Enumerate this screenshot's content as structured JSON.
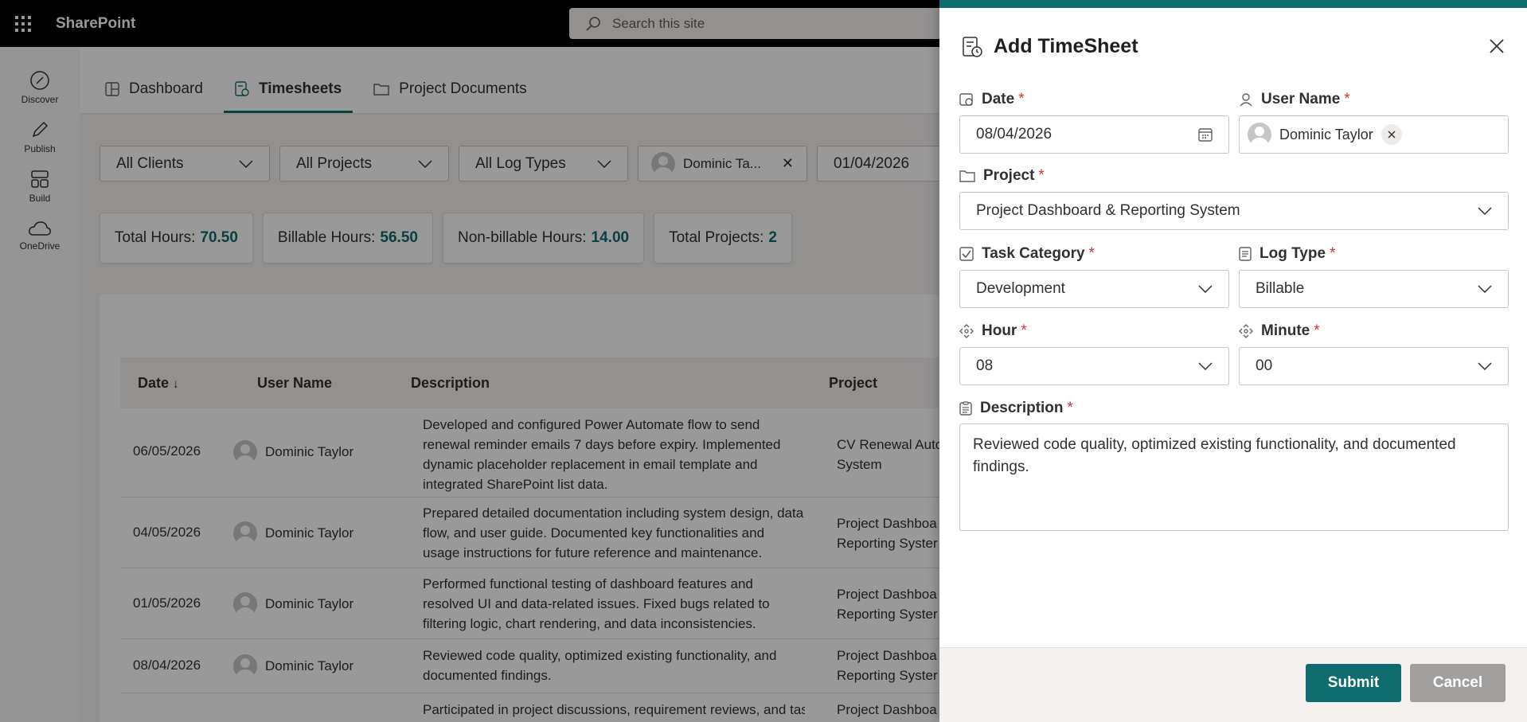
{
  "suite": {
    "brand": "SharePoint",
    "search_placeholder": "Search this site"
  },
  "rail": [
    {
      "label": "Discover",
      "icon": "compass-icon"
    },
    {
      "label": "Publish",
      "icon": "pen-icon"
    },
    {
      "label": "Build",
      "icon": "layout-icon"
    },
    {
      "label": "OneDrive",
      "icon": "cloud-icon"
    }
  ],
  "nav": {
    "tabs": [
      {
        "label": "Dashboard",
        "icon": "dashboard-icon"
      },
      {
        "label": "Timesheets",
        "icon": "timesheet-icon",
        "active": true
      },
      {
        "label": "Project Documents",
        "icon": "folder-icon"
      }
    ]
  },
  "filters": {
    "clients": "All Clients",
    "projects": "All Projects",
    "log_types": "All Log Types",
    "user": "Dominic Ta...",
    "date": "01/04/2026"
  },
  "stats": [
    {
      "label": "Total Hours:",
      "value": "70.50"
    },
    {
      "label": "Billable Hours:",
      "value": "56.50"
    },
    {
      "label": "Non-billable Hours:",
      "value": "14.00"
    },
    {
      "label": "Total Projects:",
      "value": "2"
    }
  ],
  "table": {
    "headers": {
      "date": "Date",
      "sort_arrow": "↓",
      "user": "User Name",
      "description": "Description",
      "project": "Project"
    },
    "rows": [
      {
        "date": "06/05/2026",
        "user": "Dominic Taylor",
        "description": "Developed and configured Power Automate flow to send renewal reminder emails 7 days before expiry. Implemented dynamic placeholder replacement in email template and integrated SharePoint list data.",
        "project": "CV Renewal Auto System"
      },
      {
        "date": "04/05/2026",
        "user": "Dominic Taylor",
        "description": "Prepared detailed documentation including system design, data flow, and user guide. Documented key functionalities and usage instructions for future reference and maintenance.",
        "project": "Project Dashboa Reporting Syster"
      },
      {
        "date": "01/05/2026",
        "user": "Dominic Taylor",
        "description": "Performed functional testing of dashboard features and resolved UI and data-related issues. Fixed bugs related to filtering logic, chart rendering, and data inconsistencies.",
        "project": "Project Dashboa Reporting Syster"
      },
      {
        "date": "08/04/2026",
        "user": "Dominic Taylor",
        "description": "Reviewed code quality, optimized existing functionality, and documented findings.",
        "project": "Project Dashboa Reporting Syster"
      },
      {
        "date": "",
        "user": "",
        "description": "Participated in project discussions, requirement reviews, and task",
        "project": "Project Dashboa"
      }
    ]
  },
  "panel": {
    "title": "Add TimeSheet",
    "date_label": "Date",
    "date_value": "08/04/2026",
    "user_label": "User Name",
    "user_value": "Dominic Taylor",
    "project_label": "Project",
    "project_value": "Project Dashboard & Reporting System",
    "task_label": "Task Category",
    "task_value": "Development",
    "logtype_label": "Log Type",
    "logtype_value": "Billable",
    "hour_label": "Hour",
    "hour_value": "08",
    "minute_label": "Minute",
    "minute_value": "00",
    "description_label": "Description",
    "description_value": "Reviewed code quality, optimized existing functionality, and documented findings.",
    "required_mark": "*",
    "submit_label": "Submit",
    "cancel_label": "Cancel"
  },
  "colors": {
    "accent": "#0f6b6e",
    "required": "#d13438",
    "suite_bar": "#000000"
  }
}
